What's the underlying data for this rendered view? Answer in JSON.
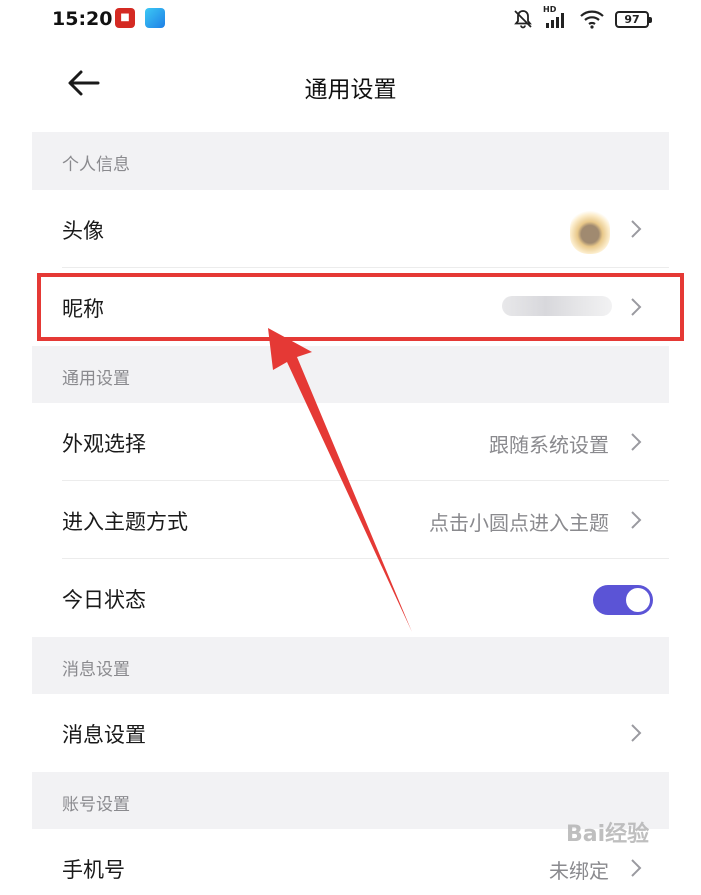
{
  "status": {
    "time": "15:20",
    "network_label": "HD",
    "battery": "97"
  },
  "header": {
    "title": "通用设置"
  },
  "sections": {
    "personal": "个人信息",
    "general": "通用设置",
    "message": "消息设置",
    "account": "账号设置"
  },
  "rows": {
    "avatar": {
      "label": "头像"
    },
    "nickname": {
      "label": "昵称"
    },
    "appearance": {
      "label": "外观选择",
      "value": "跟随系统设置"
    },
    "theme_entry": {
      "label": "进入主题方式",
      "value": "点击小圆点进入主题"
    },
    "today_status": {
      "label": "今日状态",
      "toggle_on": true
    },
    "message_settings": {
      "label": "消息设置"
    },
    "phone": {
      "label": "手机号",
      "value": "未绑定"
    }
  },
  "watermark": "Bai经验",
  "colors": {
    "accent": "#5b54d6",
    "annotation": "#e53935",
    "background": "#f2f2f4"
  },
  "icons": {
    "back": "arrow-left-icon",
    "chevron": "chevron-right-icon",
    "mute": "bell-off-icon",
    "signal": "signal-icon",
    "wifi": "wifi-icon",
    "battery": "battery-icon"
  }
}
